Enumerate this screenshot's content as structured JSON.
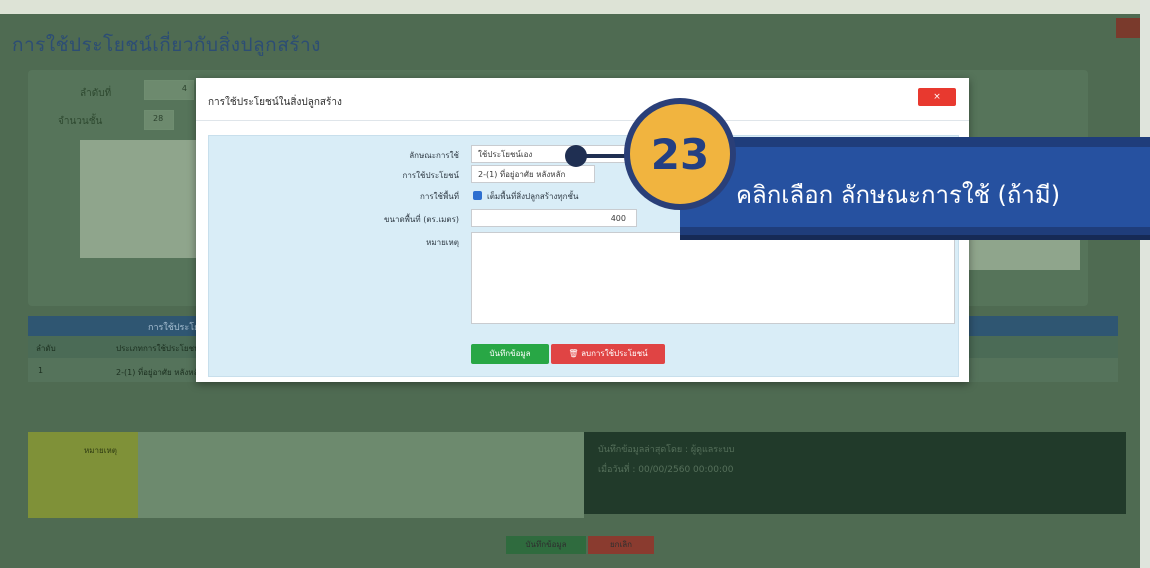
{
  "page": {
    "title": "การใช้ประโยชน์เกี่ยวกับสิ่งปลูกสร้าง",
    "background_labels": [
      "ลำดับที่",
      "จำนวนชั้น"
    ],
    "background_values": [
      "4",
      "28"
    ],
    "table": {
      "header": "การใช้ประโยชน์",
      "columns": [
        "ลำดับ",
        "ประเภทการใช้ประโยชน์"
      ],
      "rows": [
        [
          "1",
          "2-(1) ที่อยู่อาศัย หลังหลัก"
        ]
      ]
    },
    "note_label": "หมายเหตุ",
    "info_lines": [
      "บันทึกข้อมูลล่าสุดโดย : ผู้ดูแลระบบ",
      "เมื่อวันที่ : 00/00/2560 00:00:00"
    ],
    "buttons": [
      "บันทึกข้อมูล",
      "ยกเลิก"
    ],
    "colors": {
      "save": "#2f6b3e",
      "cancel": "#8a3b2f"
    }
  },
  "modal": {
    "title": "การใช้ประโยชน์ในสิ่งปลูกสร้าง",
    "close_label": "×",
    "fields": {
      "usage_type": {
        "label": "ลักษณะการใช้",
        "value": "ใช้ประโยชน์เอง"
      },
      "usage": {
        "label": "การใช้ประโยชน์",
        "value": "2-(1) ที่อยู่อาศัย หลังหลัก"
      },
      "area_use": {
        "label": "การใช้พื้นที่",
        "checkbox_text": "เต็มพื้นที่สิ่งปลูกสร้างทุกชั้น",
        "checked": true
      },
      "area_size": {
        "label": "ขนาดพื้นที่ (ตร.เมตร)",
        "value": "400"
      },
      "remark": {
        "label": "หมายเหตุ",
        "value": ""
      }
    },
    "buttons": {
      "save": "บันทึกข้อมูล",
      "delete": "ลบการใช้ประโยชน์",
      "delete_icon": "trash-icon"
    },
    "colors": {
      "save": "#28a745",
      "delete": "#e04444",
      "close": "#e8392f",
      "panel": "#d9edf7"
    }
  },
  "callout": {
    "step": "23",
    "text": "คลิกเลือก ลักษณะการใช้ (ถ้ามี)",
    "colors": {
      "bubble": "#f1b43f",
      "banner": "#2651a0",
      "ring": "#2a3f78"
    }
  }
}
